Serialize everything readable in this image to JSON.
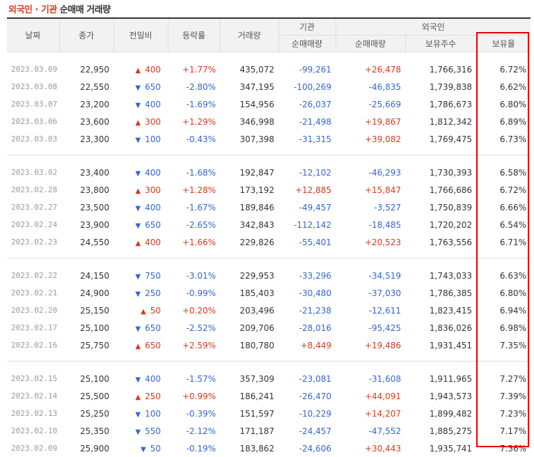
{
  "title": {
    "red_part": "외국인 · 기관",
    "dark_part": "순매매 거래량"
  },
  "headers": {
    "date": "날짜",
    "close": "종가",
    "change": "전일비",
    "rate": "등락률",
    "volume": "거래량",
    "inst_group": "기관",
    "foreign_group": "외국인",
    "inst_net": "순매매량",
    "foreign_net": "순매매량",
    "foreign_holdings": "보유주수",
    "foreign_ratio": "보유율"
  },
  "groups": [
    {
      "rows": [
        {
          "date": "2023.03.09",
          "close": "22,950",
          "dir": "up",
          "change": "400",
          "rate": "+1.77%",
          "volume": "435,072",
          "inst": "-99,261",
          "foreign": "+26,478",
          "holdings": "1,766,316",
          "ratio": "6.72%"
        },
        {
          "date": "2023.03.08",
          "close": "22,550",
          "dir": "down",
          "change": "650",
          "rate": "-2.80%",
          "volume": "347,195",
          "inst": "-100,269",
          "foreign": "-46,835",
          "holdings": "1,739,838",
          "ratio": "6.62%"
        },
        {
          "date": "2023.03.07",
          "close": "23,200",
          "dir": "down",
          "change": "400",
          "rate": "-1.69%",
          "volume": "154,956",
          "inst": "-26,037",
          "foreign": "-25,669",
          "holdings": "1,786,673",
          "ratio": "6.80%"
        },
        {
          "date": "2023.03.06",
          "close": "23,600",
          "dir": "up",
          "change": "300",
          "rate": "+1.29%",
          "volume": "346,998",
          "inst": "-21,498",
          "foreign": "+19,867",
          "holdings": "1,812,342",
          "ratio": "6.89%"
        },
        {
          "date": "2023.03.03",
          "close": "23,300",
          "dir": "down",
          "change": "100",
          "rate": "-0.43%",
          "volume": "307,398",
          "inst": "-31,315",
          "foreign": "+39,082",
          "holdings": "1,769,475",
          "ratio": "6.73%"
        }
      ]
    },
    {
      "rows": [
        {
          "date": "2023.03.02",
          "close": "23,400",
          "dir": "down",
          "change": "400",
          "rate": "-1.68%",
          "volume": "192,847",
          "inst": "-12,102",
          "foreign": "-46,293",
          "holdings": "1,730,393",
          "ratio": "6.58%"
        },
        {
          "date": "2023.02.28",
          "close": "23,800",
          "dir": "up",
          "change": "300",
          "rate": "+1.28%",
          "volume": "173,192",
          "inst": "+12,885",
          "foreign": "+15,847",
          "holdings": "1,766,686",
          "ratio": "6.72%"
        },
        {
          "date": "2023.02.27",
          "close": "23,500",
          "dir": "down",
          "change": "400",
          "rate": "-1.67%",
          "volume": "189,846",
          "inst": "-49,457",
          "foreign": "-3,527",
          "holdings": "1,750,839",
          "ratio": "6.66%"
        },
        {
          "date": "2023.02.24",
          "close": "23,900",
          "dir": "down",
          "change": "650",
          "rate": "-2.65%",
          "volume": "342,843",
          "inst": "-112,142",
          "foreign": "-18,485",
          "holdings": "1,720,202",
          "ratio": "6.54%"
        },
        {
          "date": "2023.02.23",
          "close": "24,550",
          "dir": "up",
          "change": "400",
          "rate": "+1.66%",
          "volume": "229,826",
          "inst": "-55,401",
          "foreign": "+20,523",
          "holdings": "1,763,556",
          "ratio": "6.71%"
        }
      ]
    },
    {
      "rows": [
        {
          "date": "2023.02.22",
          "close": "24,150",
          "dir": "down",
          "change": "750",
          "rate": "-3.01%",
          "volume": "229,953",
          "inst": "-33,296",
          "foreign": "-34,519",
          "holdings": "1,743,033",
          "ratio": "6.63%"
        },
        {
          "date": "2023.02.21",
          "close": "24,900",
          "dir": "down",
          "change": "250",
          "rate": "-0.99%",
          "volume": "185,403",
          "inst": "-30,480",
          "foreign": "-37,030",
          "holdings": "1,786,385",
          "ratio": "6.80%"
        },
        {
          "date": "2023.02.20",
          "close": "25,150",
          "dir": "up",
          "change": "50",
          "rate": "+0.20%",
          "volume": "203,496",
          "inst": "-21,238",
          "foreign": "-12,611",
          "holdings": "1,823,415",
          "ratio": "6.94%"
        },
        {
          "date": "2023.02.17",
          "close": "25,100",
          "dir": "down",
          "change": "650",
          "rate": "-2.52%",
          "volume": "209,706",
          "inst": "-28,016",
          "foreign": "-95,425",
          "holdings": "1,836,026",
          "ratio": "6.98%"
        },
        {
          "date": "2023.02.16",
          "close": "25,750",
          "dir": "up",
          "change": "650",
          "rate": "+2.59%",
          "volume": "180,780",
          "inst": "+8,449",
          "foreign": "+19,486",
          "holdings": "1,931,451",
          "ratio": "7.35%"
        }
      ]
    },
    {
      "rows": [
        {
          "date": "2023.02.15",
          "close": "25,100",
          "dir": "down",
          "change": "400",
          "rate": "-1.57%",
          "volume": "357,309",
          "inst": "-23,081",
          "foreign": "-31,608",
          "holdings": "1,911,965",
          "ratio": "7.27%"
        },
        {
          "date": "2023.02.14",
          "close": "25,500",
          "dir": "up",
          "change": "250",
          "rate": "+0.99%",
          "volume": "186,241",
          "inst": "-26,470",
          "foreign": "+44,091",
          "holdings": "1,943,573",
          "ratio": "7.39%"
        },
        {
          "date": "2023.02.13",
          "close": "25,250",
          "dir": "down",
          "change": "100",
          "rate": "-0.39%",
          "volume": "151,597",
          "inst": "-10,229",
          "foreign": "+14,207",
          "holdings": "1,899,482",
          "ratio": "7.23%"
        },
        {
          "date": "2023.02.10",
          "close": "25,350",
          "dir": "down",
          "change": "550",
          "rate": "-2.12%",
          "volume": "171,187",
          "inst": "-24,457",
          "foreign": "-47,552",
          "holdings": "1,885,275",
          "ratio": "7.17%"
        },
        {
          "date": "2023.02.09",
          "close": "25,900",
          "dir": "down",
          "change": "50",
          "rate": "-0.19%",
          "volume": "183,862",
          "inst": "-24,606",
          "foreign": "+30,443",
          "holdings": "1,935,741",
          "ratio": "7.36%"
        }
      ]
    }
  ],
  "icons": {
    "up": "up-triangle-icon",
    "down": "down-triangle-icon"
  },
  "colors": {
    "up": "#d8381f",
    "down": "#3366cc",
    "highlight": "#e60000",
    "header_bg": "#f2f2f2"
  }
}
